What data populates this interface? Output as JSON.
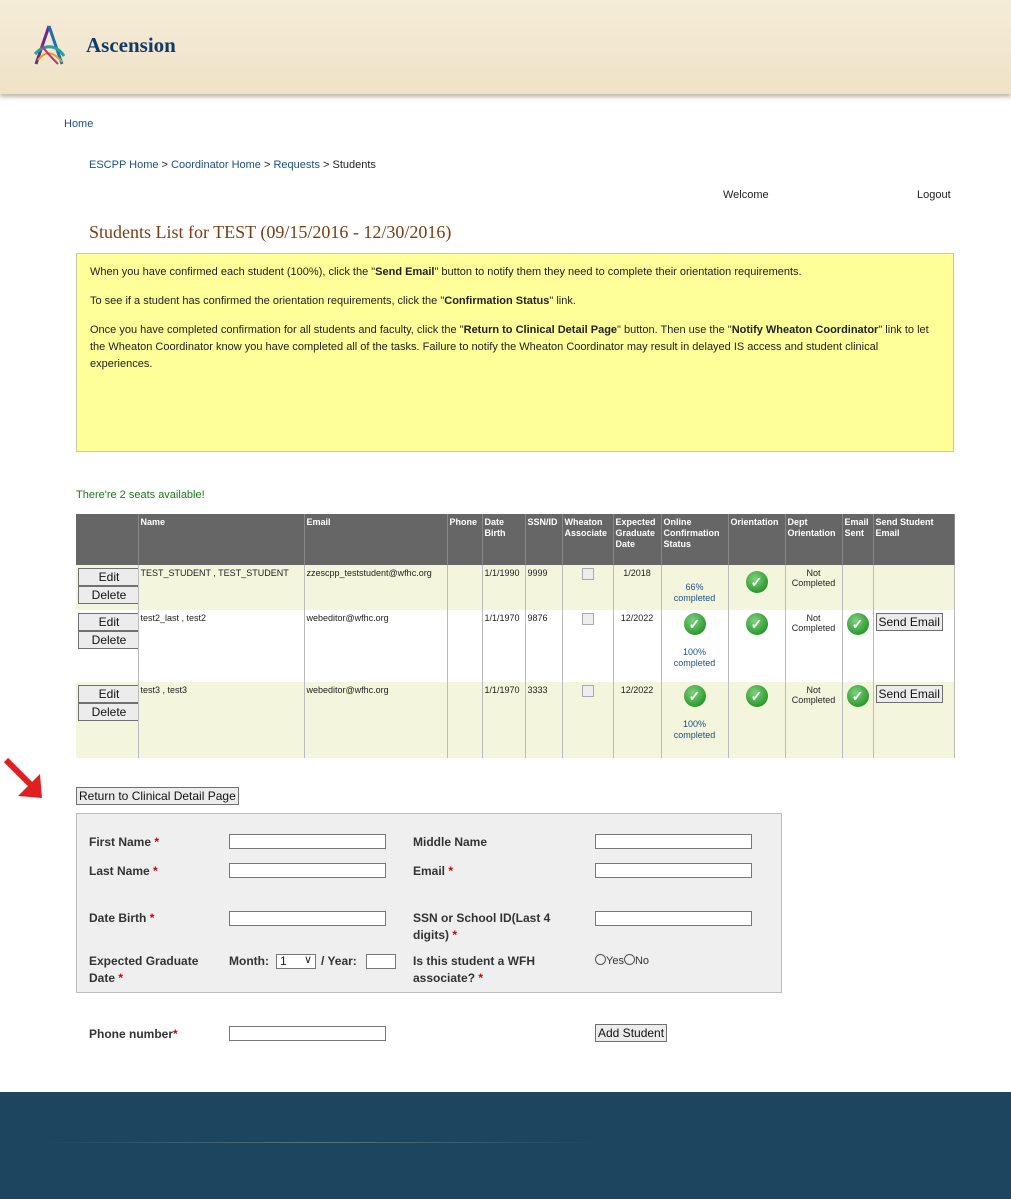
{
  "header": {
    "brand": "Ascension"
  },
  "nav": {
    "home": "Home"
  },
  "breadcrumb": {
    "item1": "ESCPP Home",
    "sep": " > ",
    "item2": "Coordinator Home",
    "item3": "Requests",
    "item4": "Students"
  },
  "user": {
    "welcome": "Welcome",
    "logout": "Logout"
  },
  "page": {
    "title": "Students List for TEST (09/15/2016 - 12/30/2016)"
  },
  "notice": {
    "p1_a": "When you have confirmed each student (100%), click the \"",
    "p1_b": "Send Email",
    "p1_c": "\" button to notify them they need to complete their orientation requirements.",
    "p2_a": "To see if a student has confirmed the orientation requirements, click the \"",
    "p2_b": "Confirmation Status",
    "p2_c": "\" link.",
    "p3_a": "Once you have completed confirmation for all students and faculty, click the \"",
    "p3_b": "Return to Clinical Detail Page",
    "p3_c": "\" button. Then use the \"",
    "p3_d": "Notify Wheaton Coordinator",
    "p3_e": "\" link to let the Wheaton Coordinator know you have completed all of the tasks. Failure to notify the Wheaton Coordinator may result in delayed IS access and student clinical experiences."
  },
  "seats": "There're 2 seats available!",
  "table": {
    "headers": [
      "",
      "Name",
      "Email",
      "Phone",
      "Date Birth",
      "SSN/ID",
      "Wheaton Associate",
      "Expected Graduate Date",
      "Online Confirmation Status",
      "Orientation",
      "Dept Orientation",
      "Email Sent",
      "Send Student Email"
    ],
    "edit_label": "Edit",
    "delete_label": "Delete",
    "send_label": "Send Email",
    "rows": [
      {
        "name": "TEST_STUDENT , TEST_STUDENT",
        "email": "zzescpp_teststudent@wfhc.org",
        "phone": "",
        "dob": "1/1/1990",
        "ssn": "9999",
        "grad": "1/2018",
        "confirm": "66% completed",
        "dept": "Not Completed"
      },
      {
        "name": "test2_last , test2",
        "email": "webeditor@wfhc.org",
        "phone": "",
        "dob": "1/1/1970",
        "ssn": "9876",
        "grad": "12/2022",
        "confirm": "100% completed",
        "dept": "Not Completed"
      },
      {
        "name": "test3 , test3",
        "email": "webeditor@wfhc.org",
        "phone": "",
        "dob": "1/1/1970",
        "ssn": "3333",
        "grad": "12/2022",
        "confirm": "100% completed",
        "dept": "Not Completed"
      }
    ]
  },
  "return_button": "Return to Clinical Detail Page",
  "form": {
    "first_name": "First Name",
    "last_name": "Last Name",
    "middle_name": "Middle Name",
    "email": "Email",
    "dob": "Date Birth",
    "ssn": "SSN or School ID(Last 4 digits)",
    "grad": "Expected Graduate Date",
    "month_label": "Month:",
    "month_value": "1",
    "year_label": "/ Year:",
    "wfh_question": "Is this student a WFH associate?",
    "yes": "Yes",
    "no": "No",
    "phone": "Phone number",
    "required": "*",
    "add_button": "Add Student"
  },
  "colors": {
    "title": "#7a3e12",
    "brand": "#0f3b66",
    "notice_bg": "#ffff99",
    "footer": "#1c465f",
    "header_row": "#666666",
    "arrow": "#e02020"
  }
}
